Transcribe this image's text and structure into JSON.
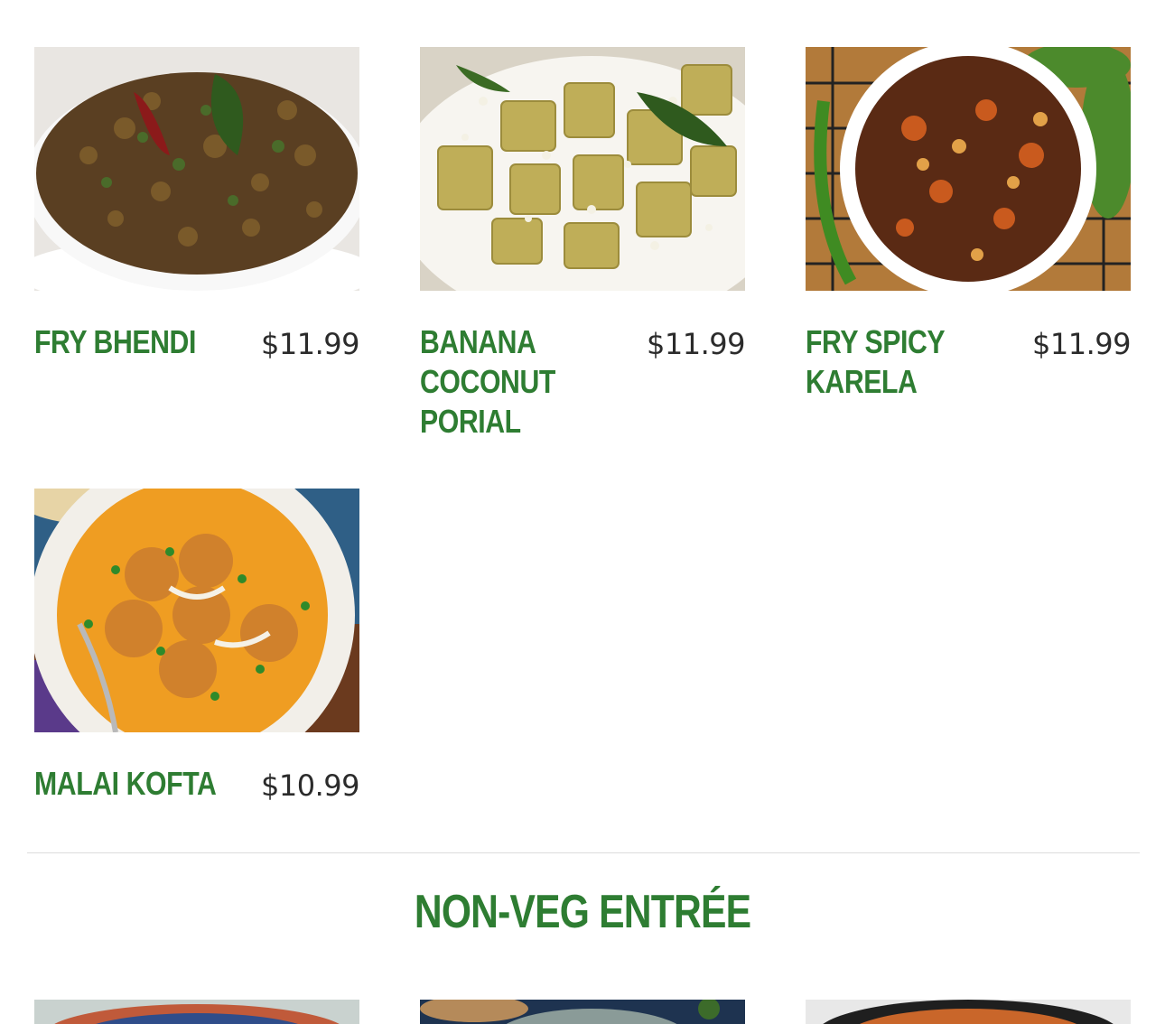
{
  "veg_items": [
    {
      "name": "FRY BHENDI",
      "price": "$11.99",
      "image": "okra-fry-photo"
    },
    {
      "name": "BANANA COCONUT PORIAL",
      "price": "$11.99",
      "image": "banana-coconut-porial-photo"
    },
    {
      "name": "FRY SPICY KARELA",
      "price": "$11.99",
      "image": "karela-fry-photo"
    },
    {
      "name": "MALAI KOFTA",
      "price": "$10.99",
      "image": "malai-kofta-photo"
    }
  ],
  "section": {
    "title": "NON-VEG ENTRÉE"
  },
  "colors": {
    "accent": "#2e7d32",
    "price": "#2b2b2b",
    "divider": "#dcdcdc"
  }
}
